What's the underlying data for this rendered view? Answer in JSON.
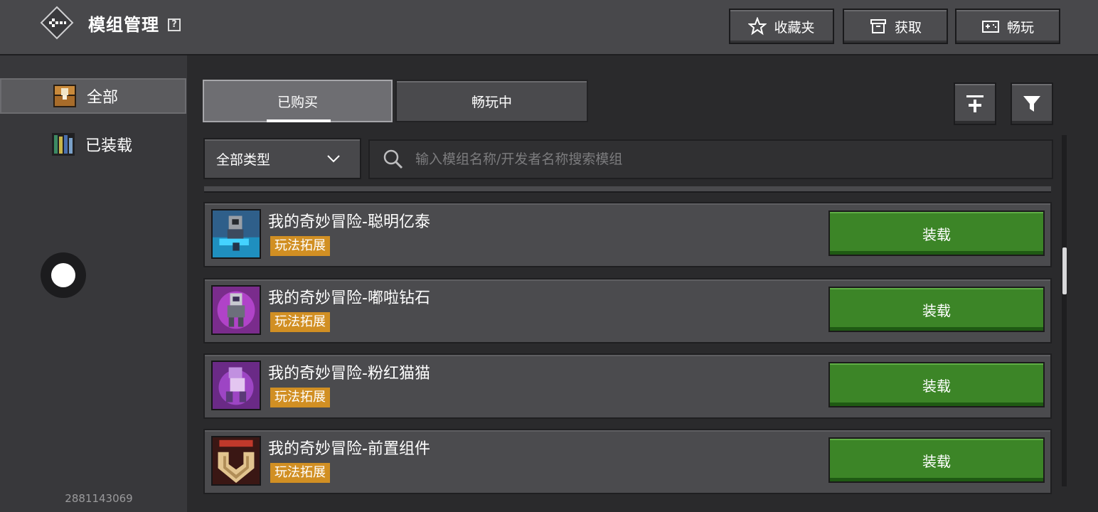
{
  "header": {
    "title": "模组管理",
    "help": "?",
    "buttons": [
      {
        "label": "收藏夹",
        "icon": "star-icon"
      },
      {
        "label": "获取",
        "icon": "box-icon"
      },
      {
        "label": "畅玩",
        "icon": "gamepad-icon"
      }
    ]
  },
  "sidebar": {
    "items": [
      {
        "label": "全部",
        "icon": "chest-icon",
        "active": true
      },
      {
        "label": "已装载",
        "icon": "bookshelf-icon",
        "active": false
      }
    ],
    "user_id": "2881143069"
  },
  "tabs": [
    {
      "label": "已购买",
      "active": true
    },
    {
      "label": "畅玩中",
      "active": false
    }
  ],
  "filter": {
    "type_select": "全部类型",
    "search_placeholder": "输入模组名称/开发者名称搜索模组"
  },
  "mods": [
    {
      "name": "我的奇妙冒险-聪明亿泰",
      "tag": "玩法拓展",
      "action": "装载"
    },
    {
      "name": "我的奇妙冒险-嘟啦钻石",
      "tag": "玩法拓展",
      "action": "装载"
    },
    {
      "name": "我的奇妙冒险-粉红猫猫",
      "tag": "玩法拓展",
      "action": "装载"
    },
    {
      "name": "我的奇妙冒险-前置组件",
      "tag": "玩法拓展",
      "action": "装载"
    }
  ],
  "colors": {
    "accent_green": "#3c8527",
    "tag_orange": "#d18f23",
    "background": "#2a2a2c"
  }
}
